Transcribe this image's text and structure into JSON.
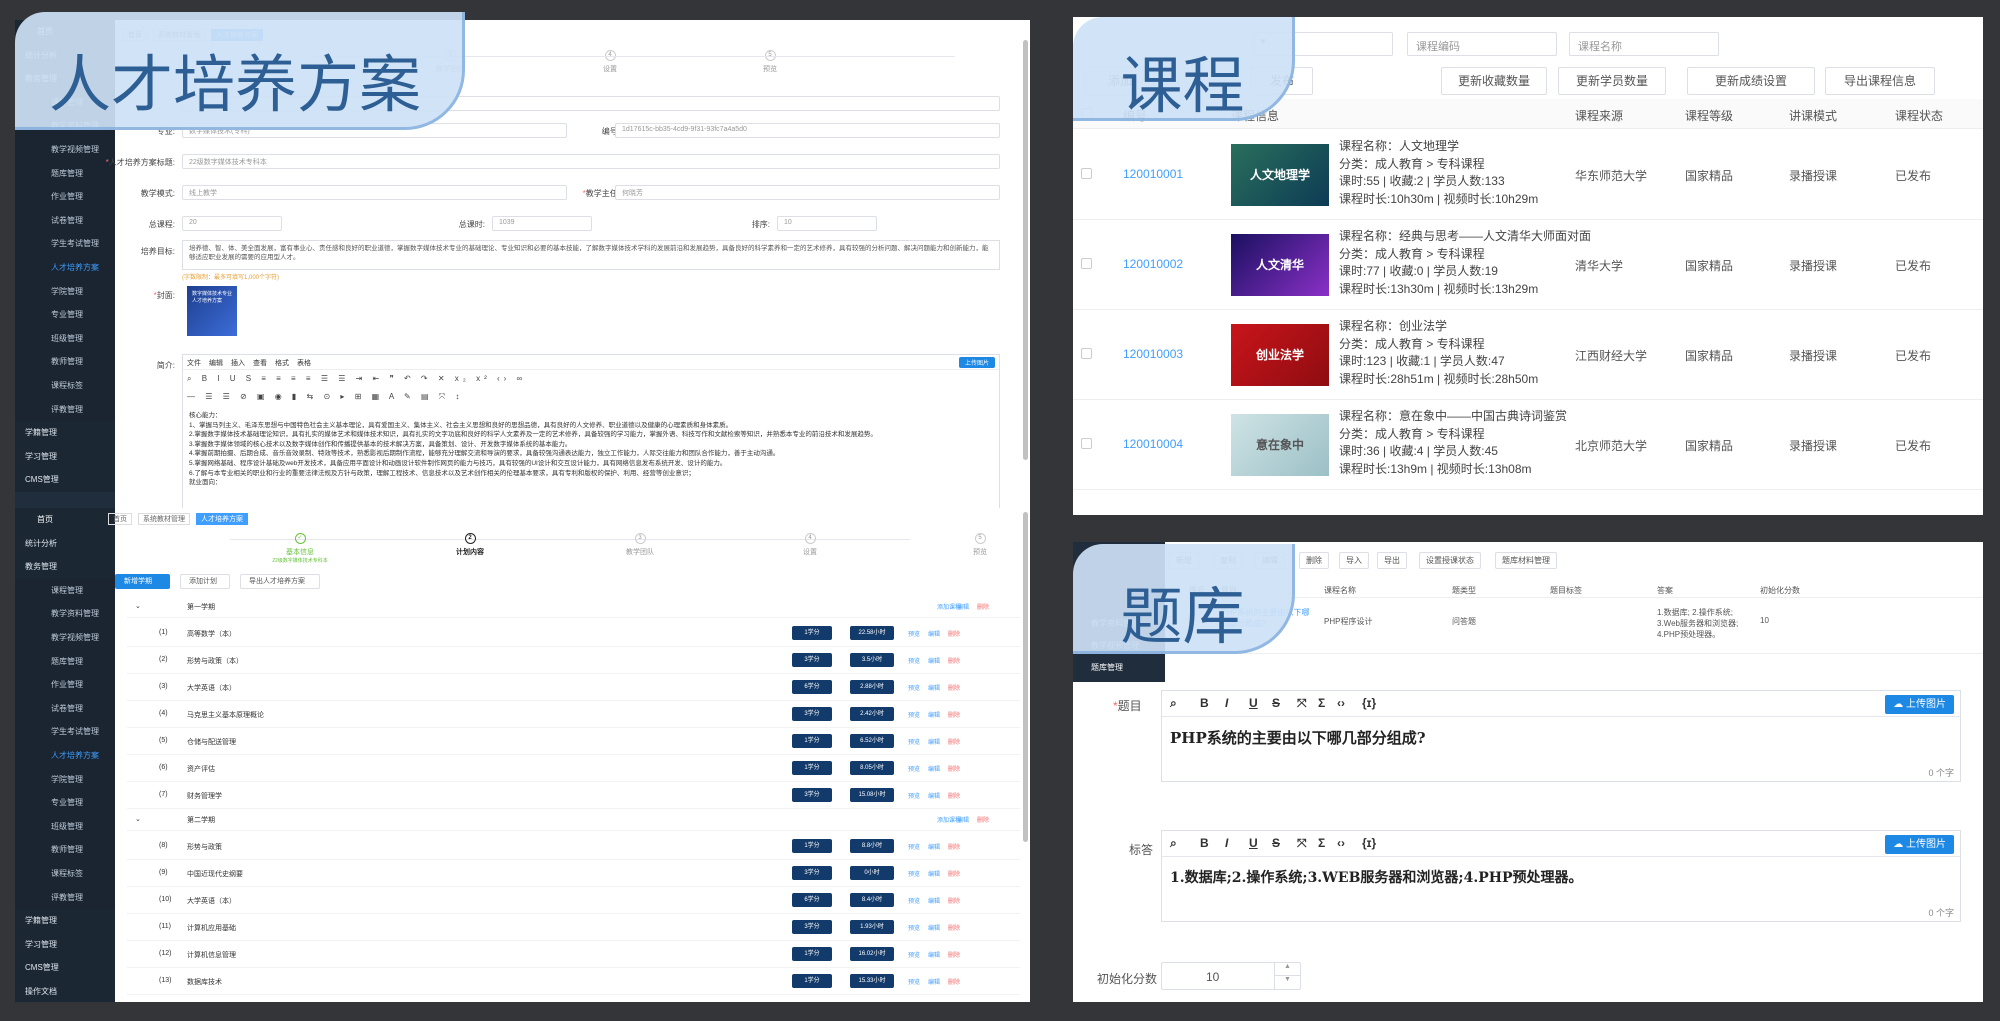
{
  "badges": {
    "talent": "人才培养方案",
    "course": "课程",
    "question": "题库"
  },
  "talent_top": {
    "sidebar": {
      "brand": "首页",
      "items": [
        "统计分析",
        "教务管理",
        "课程管理",
        "教学资料管理",
        "教学视频管理",
        "题库管理",
        "作业管理",
        "试卷管理",
        "学生考试管理",
        "人才培养方案",
        "学院管理",
        "专业管理",
        "班级管理",
        "教师管理",
        "课程标签",
        "评教管理",
        "学籍管理",
        "学习管理",
        "CMS管理"
      ]
    },
    "breadcrumb": [
      "首页",
      "系统教材管理",
      "人才培养方案"
    ],
    "steps": [
      "教学团队",
      "设置",
      "预览"
    ],
    "form": {
      "major_label": "专业:",
      "major_value": "数字媒体技术(专科)",
      "code_label": "编号:",
      "code_value": "1d17615c-bb35-4cd9-9f31-93fc7a4a5d0",
      "title_label": "人才培养方案标题:",
      "title_value": "22级数字媒体技术专科本",
      "mode_label": "教学模式:",
      "mode_value": "线上教学",
      "director_label": "教学主任:",
      "director_value": "何晓芳",
      "credits_label": "总课程:",
      "credits_value": "20",
      "hours_label": "总课时:",
      "hours_value": "1039",
      "score_label": "排序:",
      "score_value": "10",
      "goal_label": "培养目标:",
      "goal_value": "培养德、智、体、美全面发展，富有事业心、责任感和良好的职业道德，掌握数字媒体技术专业的基础理论、专业知识和必要的基本技能，了解数字媒体技术学科的发展前沿和发展趋势，具备良好的科学素养和一定的艺术修养，具有较强的分析问题、解决问题能力和创新能力，能够适应职业发展的需要的应用型人才。",
      "goal_hint": "(字数限制：最多可填写1,000个字符)",
      "cover_label": "封面:",
      "cover_text": "数字媒体技术专业人才培养方案",
      "intro_label": "简介:",
      "menus": [
        "文件",
        "编辑",
        "插入",
        "查看",
        "格式",
        "表格"
      ],
      "upload": "上传图片",
      "intro_lines": [
        "核心能力：",
        "1、掌握马列主义、毛泽东思想与中国特色社会主义基本理论，具有爱国主义、集体主义、社会主义思想和良好的思想品德，具有良好的人文修养、职业道德以及健康的心理素质和身体素质。",
        "2.掌握数字媒体技术基础理论知识，具有扎实的媒体艺术和媒体技术知识，具有扎实的文字功底和良好的科学人文素养及一定的艺术修养，具备较强的学习能力，掌握外语、科技写作和文献检索等知识，并熟悉本专业的前沿技术和发展趋势。",
        "3.掌握数字媒体领域的核心技术以及数字媒体创作和传播提供基本的技术解决方案，具备策划、设计、开发数字媒体系统的基本能力。",
        "4.掌握前期拍摄、后期合成、音乐音效录制、特效等技术，熟悉影视后期制作流程，能够充分理解交流和导演的要求，具备较强沟通表达能力，独立工作能力，人际交往能力和团队合作能力，善于主动沟通。",
        "5.掌握网络基础、程序设计基础及web开发技术，具备应用平面设计和动画设计软件制作网页的能力与技巧，具有较强的UI设计和交互设计能力，具有网络信息发布系统开发、设计的能力。",
        "6.了解与本专业相关的职业和行业的重要法律法规及方针与政策，理解工程技术、信息技术以及艺术创作相关的伦理基本要求，具有专利和版权的保护、利用、经营等创业意识；",
        "就业面向："
      ]
    }
  },
  "talent_bottom": {
    "sidebar": {
      "brand": "首页",
      "items": [
        "统计分析",
        "教务管理",
        "课程管理",
        "教学资料管理",
        "教学视频管理",
        "题库管理",
        "作业管理",
        "试卷管理",
        "学生考试管理",
        "人才培养方案",
        "学院管理",
        "专业管理",
        "班级管理",
        "教师管理",
        "课程标签",
        "评教管理",
        "学籍管理",
        "学习管理",
        "CMS管理",
        "操作文档"
      ]
    },
    "breadcrumb": [
      "首页",
      "系统教材管理",
      "人才培养方案"
    ],
    "steps": [
      {
        "label": "基本信息",
        "note": "22级数字媒体技术专科本"
      },
      {
        "label": "计划内容",
        "note": ""
      },
      {
        "label": "教学团队",
        "note": ""
      },
      {
        "label": "设置",
        "note": ""
      },
      {
        "label": "预览",
        "note": ""
      }
    ],
    "buttons": [
      "新增学期",
      "添加计划",
      "导出人才培养方案"
    ],
    "term_actions": [
      "添加课程",
      "编辑",
      "删除"
    ],
    "row_actions": [
      "预览",
      "编辑",
      "删除"
    ],
    "terms": [
      {
        "name": "第一学期",
        "rows": [
          {
            "no": "(1)",
            "name": "高等数学（本）",
            "credit": "1学分",
            "hours": "22.58小时"
          },
          {
            "no": "(2)",
            "name": "形势与政策（本）",
            "credit": "3学分",
            "hours": "3.5小时"
          },
          {
            "no": "(3)",
            "name": "大学英语（本）",
            "credit": "6学分",
            "hours": "2.88小时"
          },
          {
            "no": "(4)",
            "name": "马克思主义基本原理概论",
            "credit": "3学分",
            "hours": "2.42小时"
          },
          {
            "no": "(5)",
            "name": "仓储与配送管理",
            "credit": "1学分",
            "hours": "6.52小时"
          },
          {
            "no": "(6)",
            "name": "资产评估",
            "credit": "1学分",
            "hours": "8.05小时"
          },
          {
            "no": "(7)",
            "name": "财务管理学",
            "credit": "3学分",
            "hours": "15.08小时"
          }
        ]
      },
      {
        "name": "第二学期",
        "rows": [
          {
            "no": "(8)",
            "name": "形势与政策",
            "credit": "1学分",
            "hours": "8.8小时"
          },
          {
            "no": "(9)",
            "name": "中国近现代史纲要",
            "credit": "3学分",
            "hours": "0小时"
          },
          {
            "no": "(10)",
            "name": "大学英语（本）",
            "credit": "6学分",
            "hours": "8.4小时"
          },
          {
            "no": "(11)",
            "name": "计算机应用基础",
            "credit": "3学分",
            "hours": "1.93小时"
          },
          {
            "no": "(12)",
            "name": "计算机信息管理",
            "credit": "1学分",
            "hours": "16.02小时"
          },
          {
            "no": "(13)",
            "name": "数据库技术",
            "credit": "1学分",
            "hours": "15.33小时"
          }
        ]
      }
    ]
  },
  "course": {
    "filters": [
      "课程编码",
      "课程名称"
    ],
    "buttons": [
      "添加",
      "发布",
      "更新收藏数量",
      "更新学员数量",
      "更新成绩设置",
      "导出课程信息"
    ],
    "columns": [
      "编号",
      "课程信息",
      "课程来源",
      "课程等级",
      "讲课模式",
      "课程状态"
    ],
    "rows": [
      {
        "id": "120010001",
        "name": "课程名称：人文地理学",
        "cat": "分类：成人教育 > 专科课程",
        "stats": "课时:55 | 收藏:2 | 学员人数:133",
        "dur": "课程时长:10h30m | 视频时长:10h29m",
        "source": "华东师范大学",
        "level": "国家精品",
        "mode": "录播授课",
        "status": "已发布"
      },
      {
        "id": "120010002",
        "name": "课程名称：经典与思考——人文清华大师面对面",
        "cat": "分类：成人教育 > 专科课程",
        "stats": "课时:77 | 收藏:0 | 学员人数:19",
        "dur": "课程时长:13h30m | 视频时长:13h29m",
        "source": "清华大学",
        "level": "国家精品",
        "mode": "录播授课",
        "status": "已发布"
      },
      {
        "id": "120010003",
        "name": "课程名称：创业法学",
        "cat": "分类：成人教育 > 专科课程",
        "stats": "课时:123 | 收藏:1 | 学员人数:47",
        "dur": "课程时长:28h51m | 视频时长:28h50m",
        "source": "江西财经大学",
        "level": "国家精品",
        "mode": "录播授课",
        "status": "已发布"
      },
      {
        "id": "120010004",
        "name": "课程名称：意在象中——中国古典诗词鉴赏",
        "cat": "分类：成人教育 > 专科课程",
        "stats": "课时:36 | 收藏:4 | 学员人数:45",
        "dur": "课程时长:13h9m | 视频时长:13h08m",
        "source": "北京师范大学",
        "level": "国家精品",
        "mode": "录播授课",
        "status": "已发布"
      }
    ],
    "thumb_texts": [
      "人文地理学",
      "人文清华",
      "创业法学",
      "意在象中"
    ]
  },
  "question": {
    "sidebar": [
      "教学资料管理",
      "教学视频管理",
      "题库管理"
    ],
    "buttons": [
      "新增",
      "复制",
      "编辑",
      "删除",
      "导入",
      "导出",
      "设置授课状态",
      "题库材料管理"
    ],
    "columns": [
      "序号",
      "题目",
      "课程名称",
      "题类型",
      "题目标签",
      "答案",
      "初始化分数"
    ],
    "row": {
      "no": "1",
      "title": "PHP系统的主要由以下哪几部分组成?",
      "course": "PHP程序设计",
      "type": "问答题",
      "tag": "",
      "answer": "1.数据库; 2.操作系统; 3.Web服务器和浏览器; 4.PHP预处理器。",
      "score": "10"
    },
    "editor": {
      "title_label": "题目",
      "title_text": "PHP系统的主要由以下哪几部分组成?",
      "answer_label": "标答",
      "answer_text": "1.数据库;2.操作系统;3.WEB服务器和浏览器;4.PHP预处理器。",
      "upload": "上传图片",
      "count": "0 个字",
      "score_label": "初始化分数",
      "score_value": "10"
    }
  },
  "colors": {
    "sidebar": "#1f2d3d",
    "accent": "#409eff",
    "pill": "#123a6b",
    "background": "#333538"
  }
}
